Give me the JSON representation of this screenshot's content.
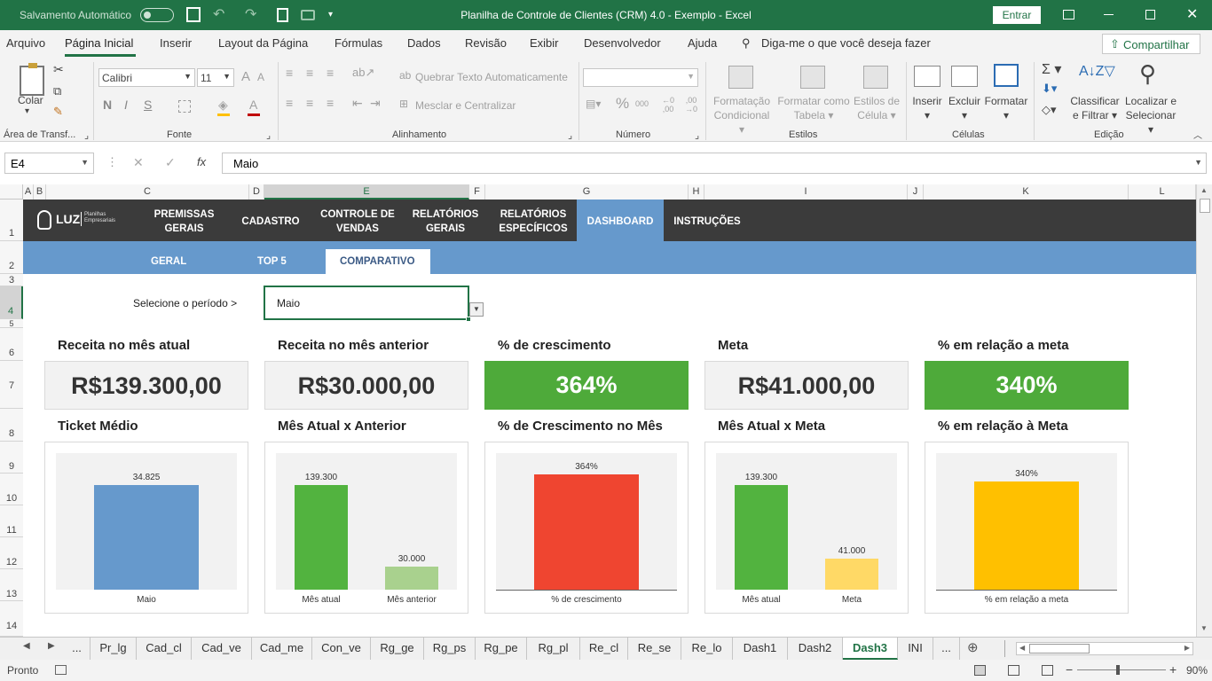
{
  "titlebar": {
    "autosave": "Salvamento Automático",
    "title": "Planilha de Controle de Clientes (CRM) 4.0 - Exemplo  -  Excel",
    "signin": "Entrar"
  },
  "menu": {
    "items": [
      "Arquivo",
      "Página Inicial",
      "Inserir",
      "Layout da Página",
      "Fórmulas",
      "Dados",
      "Revisão",
      "Exibir",
      "Desenvolvedor",
      "Ajuda"
    ],
    "tellme": "Diga-me o que você deseja fazer",
    "share": "Compartilhar"
  },
  "ribbon": {
    "paste": "Colar",
    "clipboard": "Área de Transf...",
    "font_name": "Calibri",
    "font_size": "11",
    "font_group": "Fonte",
    "wrap": "Quebrar Texto Automaticamente",
    "merge": "Mesclar e Centralizar",
    "align_group": "Alinhamento",
    "number_group": "Número",
    "cond_format": [
      "Formatação",
      "Condicional"
    ],
    "format_table": [
      "Formatar como",
      "Tabela"
    ],
    "cell_styles": [
      "Estilos de",
      "Célula"
    ],
    "styles_group": "Estilos",
    "insert": "Inserir",
    "delete": "Excluir",
    "format": "Formatar",
    "cells_group": "Células",
    "sort": [
      "Classificar",
      "e Filtrar"
    ],
    "find": [
      "Localizar e",
      "Selecionar"
    ],
    "editing_group": "Edição",
    "bold": "N",
    "italic": "I",
    "underline": "S"
  },
  "formula": {
    "cell_ref": "E4",
    "value": "Maio"
  },
  "columns": [
    "A",
    "B",
    "C",
    "D",
    "E",
    "F",
    "G",
    "H",
    "I",
    "J",
    "K",
    "L"
  ],
  "rows": [
    "1",
    "2",
    "3",
    "4",
    "5",
    "6",
    "7",
    "8",
    "9",
    "10",
    "11",
    "12",
    "13",
    "14"
  ],
  "dashboard": {
    "logo": "LUZ",
    "logo_sub": [
      "Planilhas",
      "Empresariais"
    ],
    "nav": [
      [
        "PREMISSAS",
        "GERAIS"
      ],
      [
        "CADASTRO",
        ""
      ],
      [
        "CONTROLE DE",
        "VENDAS"
      ],
      [
        "RELATÓRIOS",
        "GERAIS"
      ],
      [
        "RELATÓRIOS",
        "ESPECÍFICOS"
      ],
      [
        "DASHBOARD",
        ""
      ],
      [
        "INSTRUÇÕES",
        ""
      ]
    ],
    "subnav": [
      "GERAL",
      "TOP 5",
      "COMPARATIVO"
    ],
    "period_label": "Selecione o período >",
    "period_value": "Maio",
    "kpis": [
      {
        "label": "Receita no mês atual",
        "value": "R$139.300,00",
        "color": "#f2f2f2",
        "text": "#333333"
      },
      {
        "label": "Receita no mês anterior",
        "value": "R$30.000,00",
        "color": "#f2f2f2",
        "text": "#333333"
      },
      {
        "label": "% de crescimento",
        "value": "364%",
        "color": "#4eaa3a",
        "text": "#ffffff"
      },
      {
        "label": "Meta",
        "value": "R$41.000,00",
        "color": "#f2f2f2",
        "text": "#333333"
      },
      {
        "label": "% em relação a meta",
        "value": "340%",
        "color": "#4eaa3a",
        "text": "#ffffff"
      }
    ],
    "chart_titles": [
      "Ticket Médio",
      "Mês Atual x Anterior",
      "% de Crescimento no Mês",
      "Mês Atual x Meta",
      "% em relação à Meta"
    ]
  },
  "chart_data": [
    {
      "type": "bar",
      "title": "Ticket Médio",
      "categories": [
        "Maio"
      ],
      "values": [
        34825
      ],
      "labels": [
        "34.825"
      ],
      "colors": [
        "#6699cc"
      ],
      "ylim": [
        0,
        40000
      ]
    },
    {
      "type": "bar",
      "title": "Mês Atual x Anterior",
      "categories": [
        "Mês atual",
        "Mês anterior"
      ],
      "values": [
        139300,
        30000
      ],
      "labels": [
        "139.300",
        "30.000"
      ],
      "colors": [
        "#52b33f",
        "#a9d18e"
      ],
      "ylim": [
        0,
        160000
      ]
    },
    {
      "type": "bar",
      "title": "% de Crescimento no Mês",
      "categories": [
        "% de crescimento"
      ],
      "values": [
        364
      ],
      "labels": [
        "364%"
      ],
      "colors": [
        "#ef4530"
      ],
      "ylim": [
        0,
        380
      ]
    },
    {
      "type": "bar",
      "title": "Mês Atual x Meta",
      "categories": [
        "Mês atual",
        "Meta"
      ],
      "values": [
        139300,
        41000
      ],
      "labels": [
        "139.300",
        "41.000"
      ],
      "colors": [
        "#52b33f",
        "#ffd966"
      ],
      "ylim": [
        0,
        160000
      ]
    },
    {
      "type": "bar",
      "title": "% em relação à Meta",
      "categories": [
        "% em relação a meta"
      ],
      "values": [
        340
      ],
      "labels": [
        "340%"
      ],
      "colors": [
        "#ffc000"
      ],
      "ylim": [
        0,
        380
      ]
    }
  ],
  "sheet_tabs": [
    "...",
    "Pr_lg",
    "Cad_cl",
    "Cad_ve",
    "Cad_me",
    "Con_ve",
    "Rg_ge",
    "Rg_ps",
    "Rg_pe",
    "Rg_pl",
    "Re_cl",
    "Re_se",
    "Re_lo",
    "Dash1",
    "Dash2",
    "Dash3",
    "INI",
    "..."
  ],
  "active_tab": "Dash3",
  "status": {
    "ready": "Pronto",
    "zoom": "90%"
  }
}
